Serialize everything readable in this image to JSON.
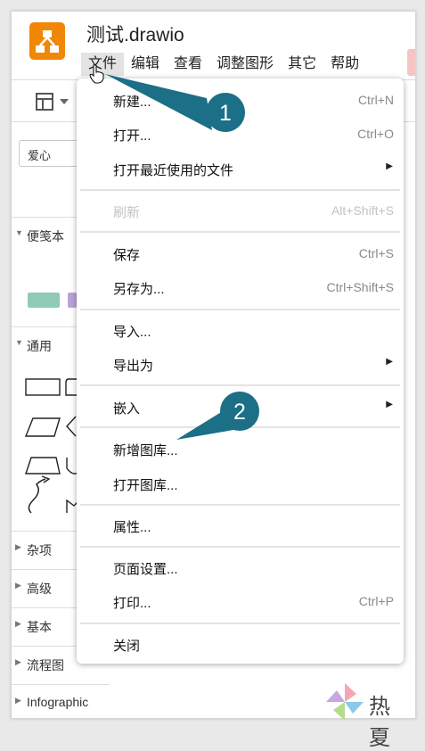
{
  "app": {
    "title": "测试.drawio"
  },
  "menubar": [
    {
      "label": "文件",
      "active": true
    },
    {
      "label": "编辑"
    },
    {
      "label": "查看"
    },
    {
      "label": "调整图形"
    },
    {
      "label": "其它"
    },
    {
      "label": "帮助"
    }
  ],
  "sidebar": {
    "search_value": "爱心",
    "sections": [
      "便笺本",
      "通用",
      "杂项",
      "高级",
      "基本",
      "流程图",
      "Infographic"
    ]
  },
  "file_menu": [
    {
      "label": "新建...",
      "shortcut": "Ctrl+N"
    },
    {
      "label": "打开...",
      "shortcut": "Ctrl+O"
    },
    {
      "label": "打开最近使用的文件",
      "submenu": true
    },
    {
      "label": "刷新",
      "shortcut": "Alt+Shift+S",
      "disabled": true
    },
    {
      "label": "保存",
      "shortcut": "Ctrl+S"
    },
    {
      "label": "另存为...",
      "shortcut": "Ctrl+Shift+S"
    },
    {
      "label": "导入..."
    },
    {
      "label": "导出为",
      "submenu": true
    },
    {
      "label": "嵌入",
      "submenu": true
    },
    {
      "label": "新增图库..."
    },
    {
      "label": "打开图库..."
    },
    {
      "label": "属性..."
    },
    {
      "label": "页面设置..."
    },
    {
      "label": "打印...",
      "shortcut": "Ctrl+P"
    },
    {
      "label": "关闭"
    }
  ],
  "callouts": {
    "one": "1",
    "two": "2"
  },
  "watermark": {
    "text": "热夏"
  },
  "colors": {
    "callout": "#1b6f86",
    "logo": "#f08705"
  }
}
